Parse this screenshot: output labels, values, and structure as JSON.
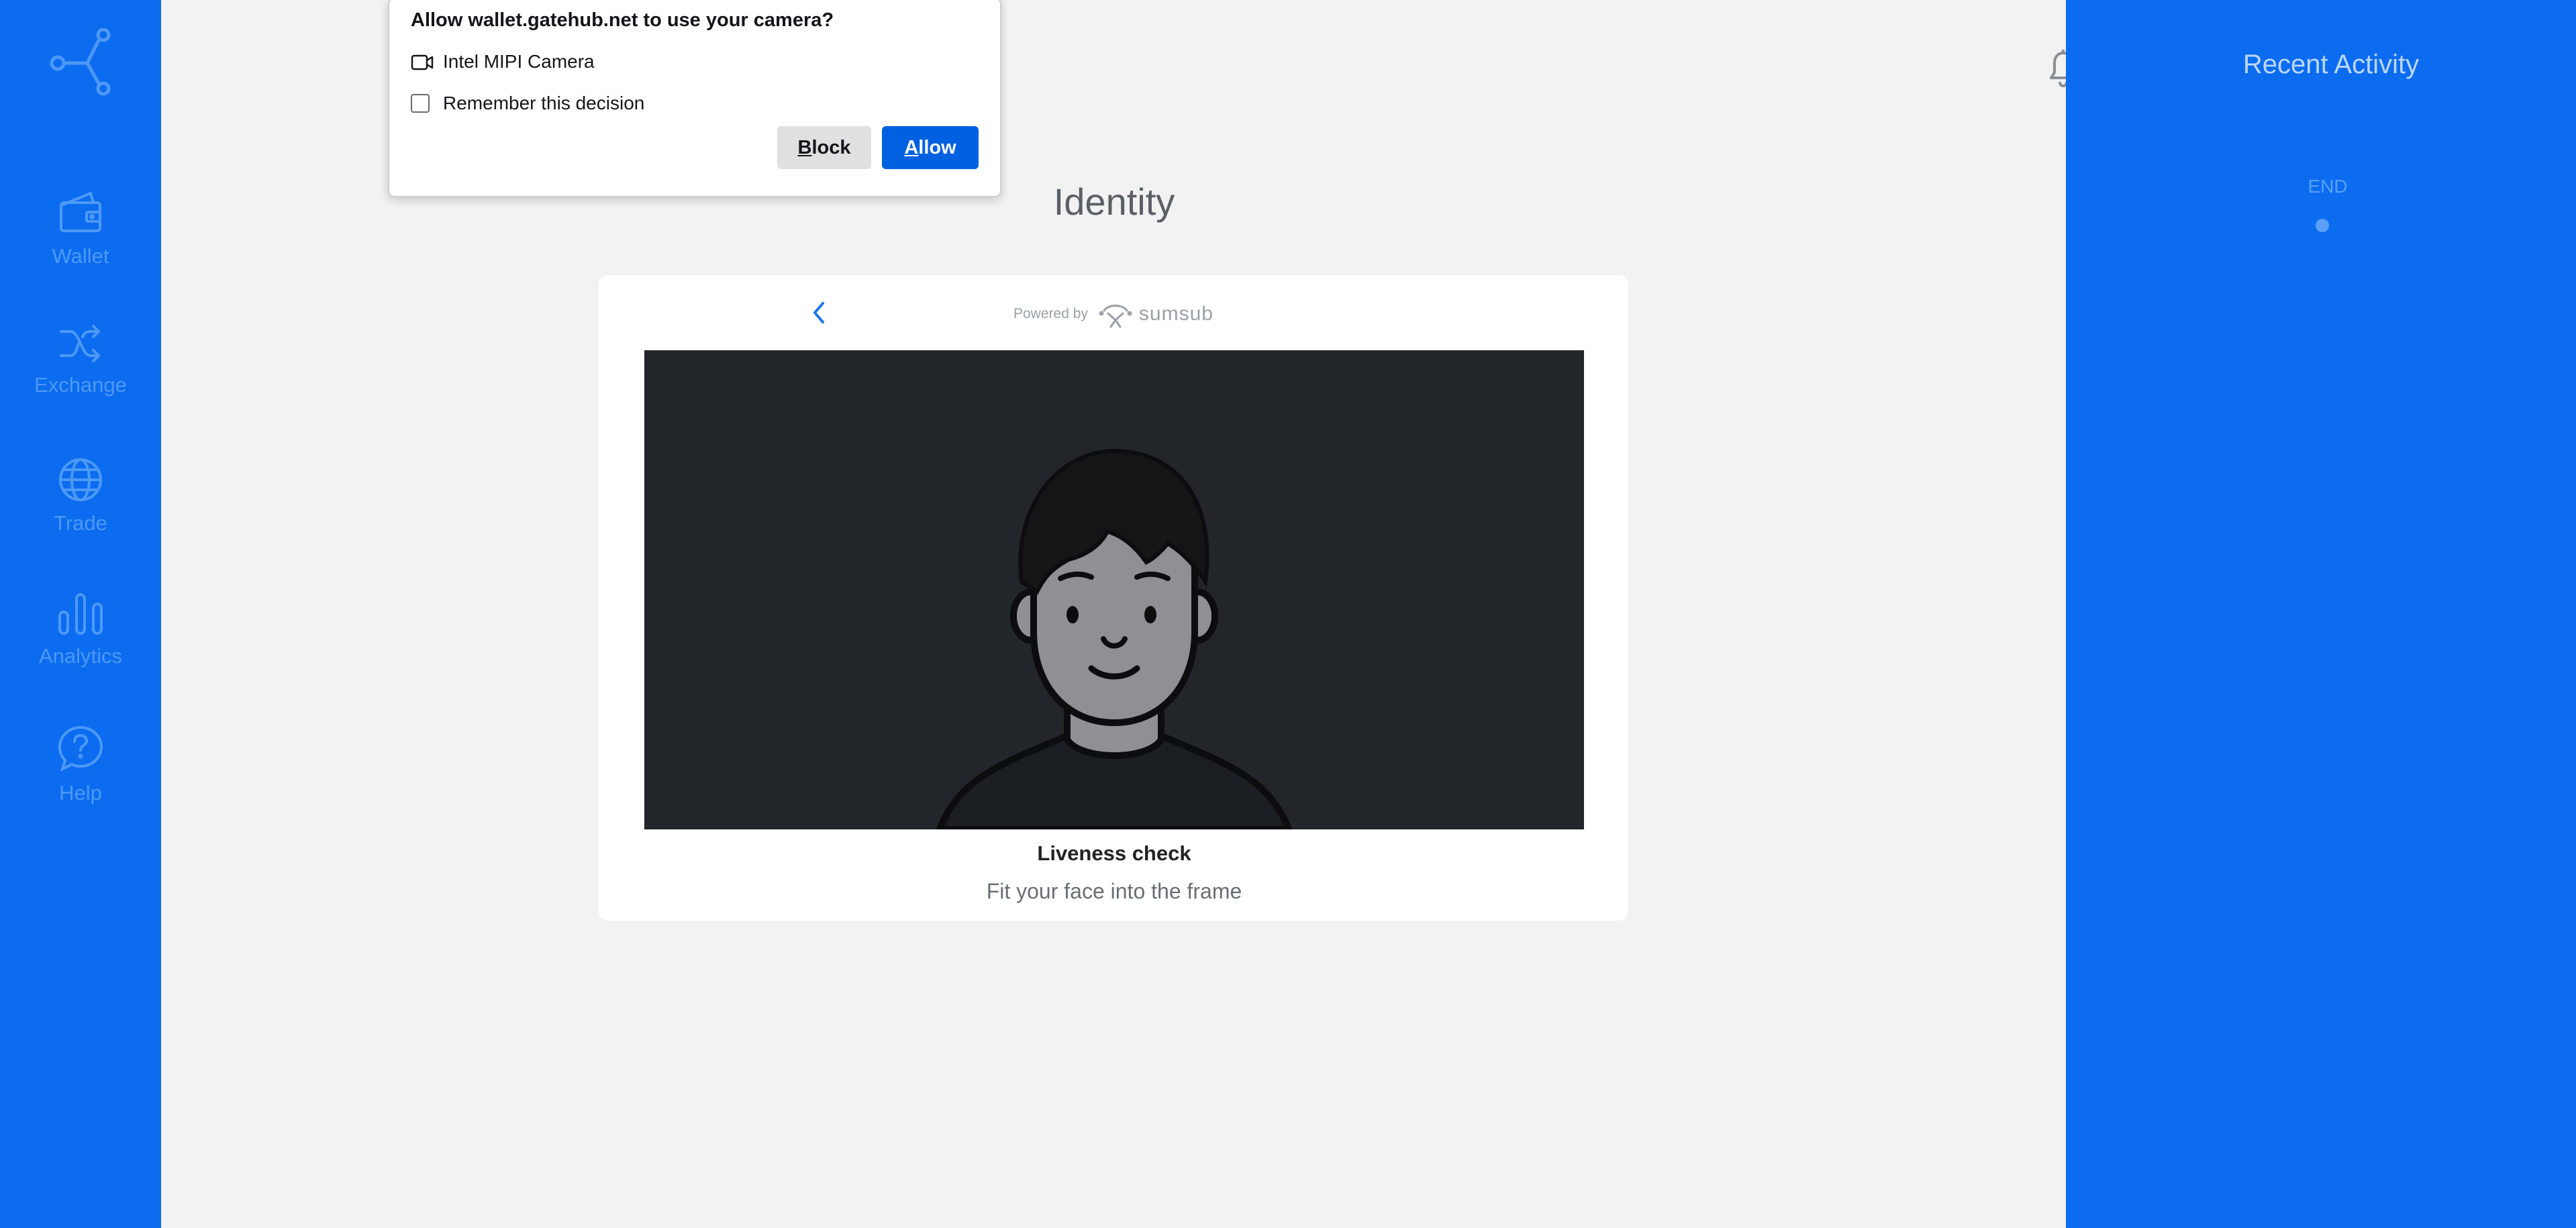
{
  "colors": {
    "brand_blue": "#0b6cf0",
    "sidebar_label": "#4d99f5",
    "main_bg": "#f2f2f2",
    "video_bg": "#22262b",
    "allow_button": "#0061e0"
  },
  "sidebar": {
    "logo_icon": "share-node-logo-icon",
    "items": [
      {
        "label": "Wallet",
        "icon": "wallet-icon"
      },
      {
        "label": "Exchange",
        "icon": "shuffle-icon"
      },
      {
        "label": "Trade",
        "icon": "globe-icon"
      },
      {
        "label": "Analytics",
        "icon": "bar-chart-icon"
      },
      {
        "label": "Help",
        "icon": "help-bubble-icon"
      }
    ]
  },
  "header": {
    "notification_icon": "bell-icon",
    "avatar_icon": "user-avatar-icon"
  },
  "main": {
    "title": "Identity",
    "card": {
      "powered_by": "Powered by",
      "provider": "sumsub",
      "liveness_title": "Liveness check",
      "liveness_subtitle": "Fit your face into the frame"
    }
  },
  "recent_activity": {
    "title": "Recent Activity",
    "end_label": "END"
  },
  "permission_prompt": {
    "title": "Allow wallet.gatehub.net to use your camera?",
    "camera_label": "Intel MIPI Camera",
    "remember_label": "Remember this decision",
    "remember_checked": false,
    "block_accesskey": "B",
    "block_rest": "lock",
    "allow_accesskey": "A",
    "allow_rest": "llow"
  }
}
